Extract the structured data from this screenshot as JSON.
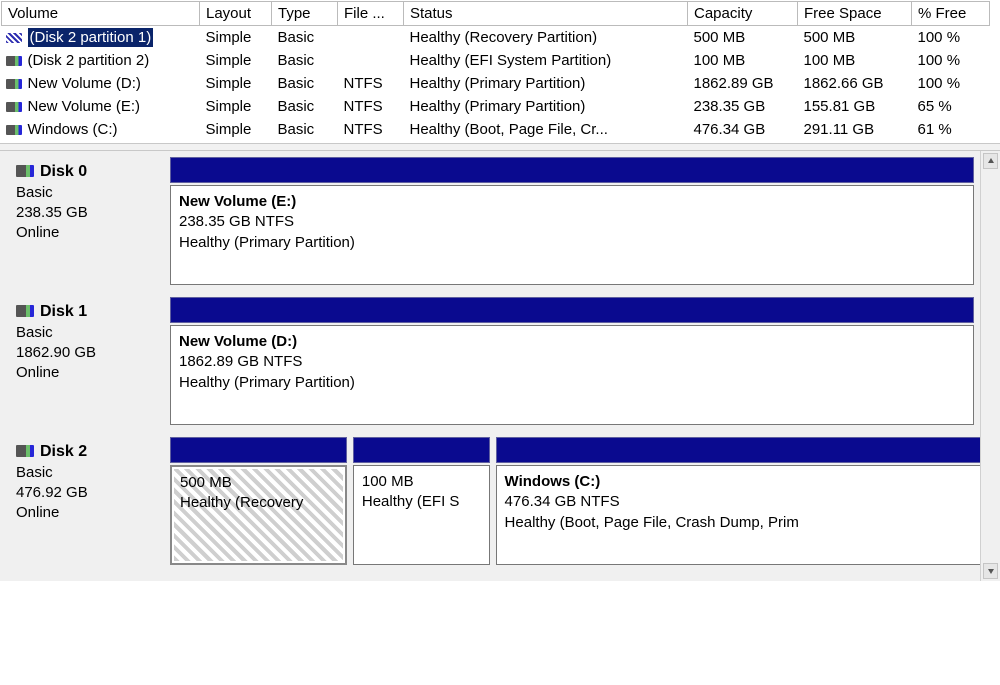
{
  "columns": {
    "volume": "Volume",
    "layout": "Layout",
    "type": "Type",
    "filesys": "File ...",
    "status": "Status",
    "capacity": "Capacity",
    "free": "Free Space",
    "pct": "% Free"
  },
  "volumes": [
    {
      "name": "(Disk 2 partition 1)",
      "layout": "Simple",
      "type": "Basic",
      "fs": "",
      "status": "Healthy (Recovery Partition)",
      "cap": "500 MB",
      "free": "500 MB",
      "pct": "100 %",
      "selected": true,
      "iconStyle": "hatch"
    },
    {
      "name": "(Disk 2 partition 2)",
      "layout": "Simple",
      "type": "Basic",
      "fs": "",
      "status": "Healthy (EFI System Partition)",
      "cap": "100 MB",
      "free": "100 MB",
      "pct": "100 %",
      "selected": false,
      "iconStyle": "normal"
    },
    {
      "name": "New Volume (D:)",
      "layout": "Simple",
      "type": "Basic",
      "fs": "NTFS",
      "status": "Healthy (Primary Partition)",
      "cap": "1862.89 GB",
      "free": "1862.66 GB",
      "pct": "100 %",
      "selected": false,
      "iconStyle": "normal"
    },
    {
      "name": "New Volume (E:)",
      "layout": "Simple",
      "type": "Basic",
      "fs": "NTFS",
      "status": "Healthy (Primary Partition)",
      "cap": "238.35 GB",
      "free": "155.81 GB",
      "pct": "65 %",
      "selected": false,
      "iconStyle": "normal"
    },
    {
      "name": "Windows (C:)",
      "layout": "Simple",
      "type": "Basic",
      "fs": "NTFS",
      "status": "Healthy (Boot, Page File, Cr...",
      "cap": "476.34 GB",
      "free": "291.11 GB",
      "pct": "61 %",
      "selected": false,
      "iconStyle": "normal"
    }
  ],
  "disks": [
    {
      "name": "Disk 0",
      "type": "Basic",
      "size": "238.35 GB",
      "state": "Online",
      "partitions": [
        {
          "title": "New Volume  (E:)",
          "line2": "238.35 GB NTFS",
          "line3": "Healthy (Primary Partition)",
          "hatched": false,
          "widthPct": 100,
          "hasTopBar": false
        }
      ]
    },
    {
      "name": "Disk 1",
      "type": "Basic",
      "size": "1862.90 GB",
      "state": "Online",
      "partitions": [
        {
          "title": "New Volume  (D:)",
          "line2": "1862.89 GB NTFS",
          "line3": "Healthy (Primary Partition)",
          "hatched": false,
          "widthPct": 100,
          "hasTopBar": false
        }
      ]
    },
    {
      "name": "Disk 2",
      "type": "Basic",
      "size": "476.92 GB",
      "state": "Online",
      "partitions": [
        {
          "title": "",
          "line2": "500 MB",
          "line3": "Healthy (Recovery",
          "hatched": true,
          "widthPct": 22,
          "hasTopBar": true
        },
        {
          "title": "",
          "line2": "100 MB",
          "line3": "Healthy (EFI S",
          "hatched": false,
          "widthPct": 17,
          "hasTopBar": true
        },
        {
          "title": "Windows  (C:)",
          "line2": "476.34 GB NTFS",
          "line3": "Healthy (Boot, Page File, Crash Dump, Prim",
          "hatched": false,
          "widthPct": 61,
          "hasTopBar": true
        }
      ]
    }
  ]
}
